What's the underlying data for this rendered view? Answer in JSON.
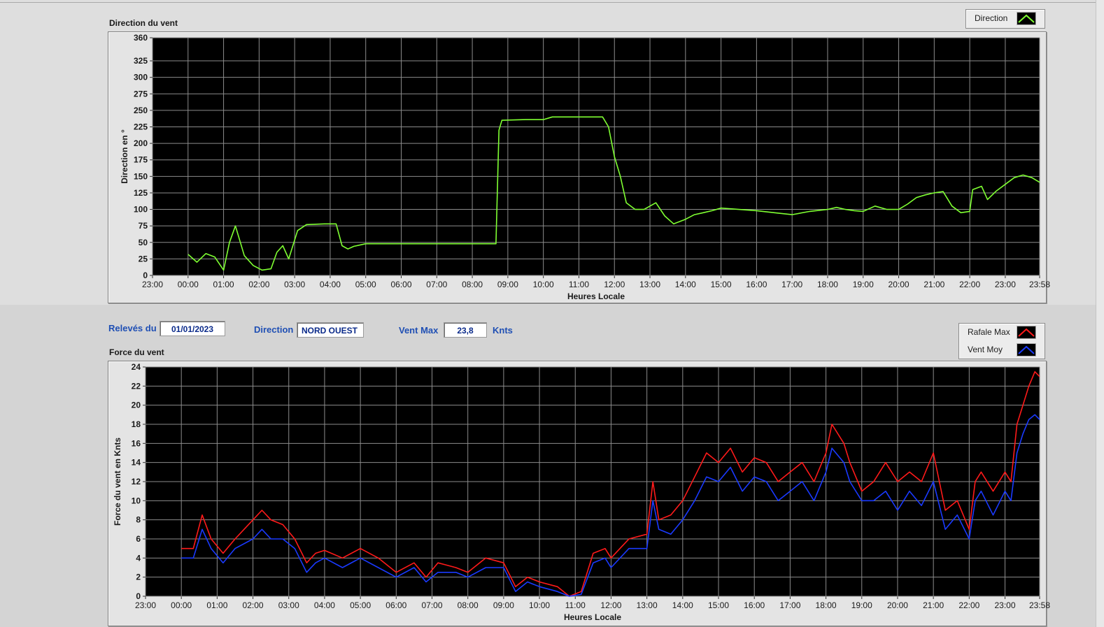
{
  "controls": {
    "releves_label": "Relevés du",
    "releves_value": "01/01/2023",
    "direction_label": "Direction",
    "direction_value": "NORD OUEST",
    "ventmax_label": "Vent Max",
    "ventmax_value": "23,8",
    "ventmax_unit": "Knts"
  },
  "colors": {
    "direction": "#7fff32",
    "rafale": "#ff1a1a",
    "moyen": "#1a3aff",
    "plot_bg": "#000000",
    "grid": "#8c8c8c"
  },
  "chart_data": [
    {
      "type": "line",
      "title": "Direction du vent",
      "xlabel": "Heures Locale",
      "ylabel": "Direction en °",
      "ylim": [
        0,
        360
      ],
      "yticks": [
        "0",
        "25",
        "50",
        "75",
        "100",
        "125",
        "150",
        "175",
        "200",
        "225",
        "250",
        "275",
        "300",
        "325",
        "360"
      ],
      "xticks": [
        "23:00",
        "00:00",
        "01:00",
        "02:00",
        "03:00",
        "04:00",
        "05:00",
        "06:00",
        "07:00",
        "08:00",
        "09:00",
        "10:00",
        "11:00",
        "12:00",
        "13:00",
        "14:00",
        "15:00",
        "16:00",
        "17:00",
        "18:00",
        "19:00",
        "20:00",
        "21:00",
        "22:00",
        "23:00",
        "23:58"
      ],
      "grid": true,
      "legend_position": "top-right",
      "series": [
        {
          "name": "Direction",
          "x": [
            "00:00",
            "00:15",
            "00:30",
            "00:45",
            "01:00",
            "01:10",
            "01:20",
            "01:35",
            "01:50",
            "02:05",
            "02:20",
            "02:30",
            "02:40",
            "02:50",
            "03:05",
            "03:20",
            "03:50",
            "04:10",
            "04:20",
            "04:30",
            "04:40",
            "05:00",
            "06:00",
            "07:00",
            "08:00",
            "08:40",
            "08:45",
            "08:50",
            "09:30",
            "10:00",
            "10:15",
            "11:00",
            "11:40",
            "11:50",
            "12:00",
            "12:10",
            "12:20",
            "12:35",
            "12:50",
            "13:10",
            "13:25",
            "13:40",
            "14:00",
            "14:15",
            "14:30",
            "14:45",
            "15:00",
            "15:30",
            "16:00",
            "16:30",
            "17:00",
            "17:30",
            "18:00",
            "18:15",
            "18:30",
            "18:45",
            "19:00",
            "19:20",
            "19:40",
            "20:00",
            "20:15",
            "20:30",
            "20:45",
            "21:00",
            "21:15",
            "21:30",
            "21:45",
            "22:00",
            "22:05",
            "22:20",
            "22:30",
            "22:45",
            "23:00",
            "23:15",
            "23:30",
            "23:45",
            "23:58"
          ],
          "values": [
            32,
            20,
            33,
            28,
            8,
            50,
            75,
            30,
            15,
            8,
            10,
            35,
            45,
            25,
            68,
            77,
            78,
            78,
            45,
            40,
            44,
            48,
            48,
            48,
            48,
            48,
            220,
            235,
            236,
            236,
            240,
            240,
            240,
            225,
            180,
            150,
            110,
            100,
            100,
            110,
            90,
            78,
            85,
            92,
            95,
            98,
            102,
            100,
            98,
            95,
            92,
            97,
            100,
            103,
            100,
            98,
            97,
            105,
            100,
            100,
            108,
            118,
            122,
            125,
            127,
            105,
            95,
            97,
            130,
            135,
            115,
            128,
            138,
            148,
            152,
            148,
            141
          ]
        }
      ]
    },
    {
      "type": "line",
      "title": "Force du vent",
      "xlabel": "Heures Locale",
      "ylabel": "Force du vent en Knts",
      "ylim": [
        0,
        24
      ],
      "yticks": [
        "0",
        "2",
        "4",
        "6",
        "8",
        "10",
        "12",
        "14",
        "16",
        "18",
        "20",
        "22",
        "24"
      ],
      "xticks": [
        "23:00",
        "00:00",
        "01:00",
        "02:00",
        "03:00",
        "04:00",
        "05:00",
        "06:00",
        "07:00",
        "08:00",
        "09:00",
        "10:00",
        "11:00",
        "12:00",
        "13:00",
        "14:00",
        "15:00",
        "16:00",
        "17:00",
        "18:00",
        "19:00",
        "20:00",
        "21:00",
        "22:00",
        "23:00",
        "23:58"
      ],
      "grid": true,
      "legend_position": "top-right",
      "series": [
        {
          "name": "Rafale Max",
          "x": [
            "00:00",
            "00:20",
            "00:35",
            "00:50",
            "01:10",
            "01:30",
            "02:00",
            "02:15",
            "02:30",
            "02:50",
            "03:10",
            "03:30",
            "03:45",
            "04:00",
            "04:30",
            "05:00",
            "05:30",
            "06:00",
            "06:30",
            "06:50",
            "07:10",
            "07:40",
            "08:00",
            "08:30",
            "09:00",
            "09:20",
            "09:40",
            "10:00",
            "10:30",
            "10:50",
            "11:10",
            "11:30",
            "11:50",
            "12:00",
            "12:30",
            "13:00",
            "13:10",
            "13:20",
            "13:40",
            "14:00",
            "14:20",
            "14:40",
            "15:00",
            "15:20",
            "15:40",
            "16:00",
            "16:20",
            "16:40",
            "17:00",
            "17:20",
            "17:40",
            "18:00",
            "18:10",
            "18:30",
            "18:40",
            "19:00",
            "19:20",
            "19:40",
            "20:00",
            "20:20",
            "20:40",
            "21:00",
            "21:20",
            "21:40",
            "22:00",
            "22:10",
            "22:20",
            "22:40",
            "23:00",
            "23:10",
            "23:20",
            "23:30",
            "23:40",
            "23:50",
            "23:58"
          ],
          "values": [
            5,
            5,
            8.5,
            6,
            4.5,
            6,
            8,
            9,
            8,
            7.5,
            6,
            3.5,
            4.5,
            4.8,
            4,
            5,
            4,
            2.5,
            3.5,
            2,
            3.5,
            3,
            2.5,
            4,
            3.5,
            1,
            2,
            1.5,
            1,
            0,
            0.5,
            4.5,
            5,
            4,
            6,
            6.5,
            12,
            8,
            8.5,
            10,
            12.5,
            15,
            14,
            15.5,
            13,
            14.5,
            14,
            12,
            13,
            14,
            12,
            15,
            18,
            16,
            14,
            11,
            12,
            14,
            12,
            13,
            12,
            15,
            9,
            10,
            7,
            12,
            13,
            11,
            13,
            12,
            18,
            20,
            22,
            23.5,
            23
          ]
        },
        {
          "name": "Vent Moy",
          "x": [
            "00:00",
            "00:20",
            "00:35",
            "00:50",
            "01:10",
            "01:30",
            "02:00",
            "02:15",
            "02:30",
            "02:50",
            "03:10",
            "03:30",
            "03:45",
            "04:00",
            "04:30",
            "05:00",
            "05:30",
            "06:00",
            "06:30",
            "06:50",
            "07:10",
            "07:40",
            "08:00",
            "08:30",
            "09:00",
            "09:20",
            "09:40",
            "10:00",
            "10:30",
            "10:50",
            "11:10",
            "11:30",
            "11:50",
            "12:00",
            "12:30",
            "13:00",
            "13:10",
            "13:20",
            "13:40",
            "14:00",
            "14:20",
            "14:40",
            "15:00",
            "15:20",
            "15:40",
            "16:00",
            "16:20",
            "16:40",
            "17:00",
            "17:20",
            "17:40",
            "18:00",
            "18:10",
            "18:30",
            "18:40",
            "19:00",
            "19:20",
            "19:40",
            "20:00",
            "20:20",
            "20:40",
            "21:00",
            "21:20",
            "21:40",
            "22:00",
            "22:10",
            "22:20",
            "22:40",
            "23:00",
            "23:10",
            "23:20",
            "23:30",
            "23:40",
            "23:50",
            "23:58"
          ],
          "values": [
            4,
            4,
            7,
            5,
            3.5,
            5,
            6,
            7,
            6,
            6,
            5,
            2.5,
            3.5,
            4,
            3,
            4,
            3,
            2,
            3,
            1.5,
            2.5,
            2.5,
            2,
            3,
            3,
            0.5,
            1.5,
            1,
            0.5,
            0,
            0.2,
            3.5,
            4,
            3,
            5,
            5,
            10,
            7,
            6.5,
            8,
            10,
            12.5,
            12,
            13.5,
            11,
            12.5,
            12,
            10,
            11,
            12,
            10,
            13,
            15.5,
            14,
            12,
            10,
            10,
            11,
            9,
            11,
            9.5,
            12,
            7,
            8.5,
            6,
            10,
            11,
            8.5,
            11,
            10,
            15,
            17,
            18.5,
            19,
            18.5
          ]
        }
      ]
    }
  ]
}
